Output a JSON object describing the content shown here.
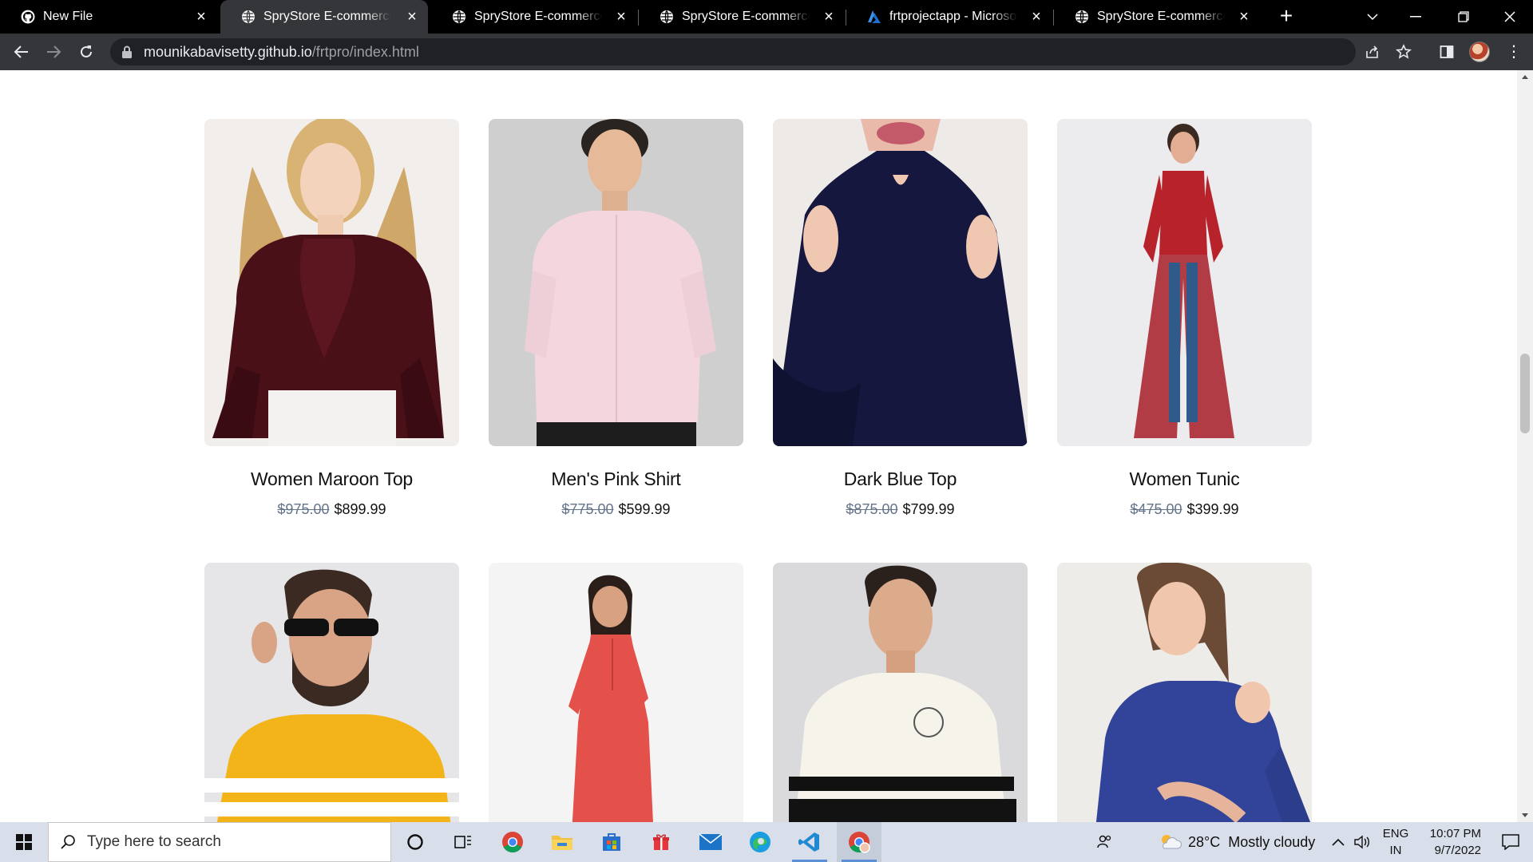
{
  "browser": {
    "tabs": [
      {
        "title": "New File",
        "icon": "github-icon",
        "active": false
      },
      {
        "title": "SpryStore E-commerce Catalog",
        "icon": "globe-icon",
        "active": true
      },
      {
        "title": "SpryStore E-commerce Catalog",
        "icon": "globe-icon",
        "active": false
      },
      {
        "title": "SpryStore E-commerce Catalog",
        "icon": "globe-icon",
        "active": false
      },
      {
        "title": "frtprojectapp - Microsoft Azure",
        "icon": "azure-icon",
        "active": false
      },
      {
        "title": "SpryStore E-commerce Catalog",
        "icon": "globe-icon",
        "active": false
      }
    ],
    "url_host": "mounikabavisetty.github.io",
    "url_path": "/frtpro/index.html"
  },
  "products": [
    {
      "name": "Women Maroon Top",
      "old_price": "$975.00",
      "price": "$899.99"
    },
    {
      "name": "Men's Pink Shirt",
      "old_price": "$775.00",
      "price": "$599.99"
    },
    {
      "name": "Dark Blue Top",
      "old_price": "$875.00",
      "price": "$799.99"
    },
    {
      "name": "Women Tunic",
      "old_price": "$475.00",
      "price": "$399.99"
    },
    {
      "name": "",
      "old_price": "",
      "price": ""
    },
    {
      "name": "",
      "old_price": "",
      "price": ""
    },
    {
      "name": "",
      "old_price": "",
      "price": ""
    },
    {
      "name": "",
      "old_price": "",
      "price": ""
    }
  ],
  "taskbar": {
    "search_placeholder": "Type here to search",
    "weather_temp": "28°C",
    "weather_text": "Mostly cloudy",
    "lang_top": "ENG",
    "lang_bottom": "IN",
    "time": "10:07 PM",
    "date": "9/7/2022"
  },
  "colors": {
    "tabbar_bg": "#000000",
    "toolbar_bg": "#35363a",
    "omnibox_bg": "#202124",
    "taskbar_bg": "#d9dfea",
    "old_price": "#64748b"
  }
}
